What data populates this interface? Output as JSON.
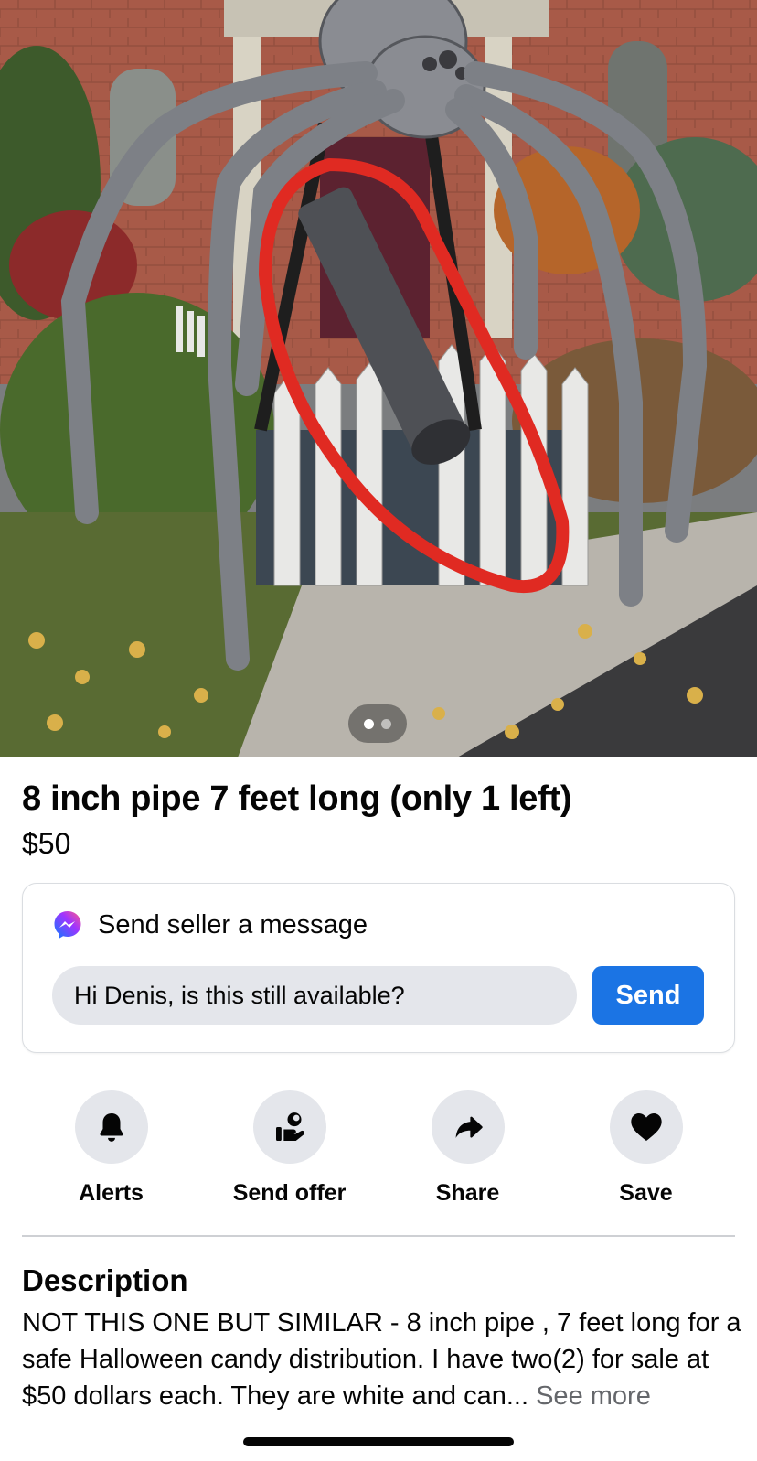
{
  "listing": {
    "title": "8 inch pipe 7 feet long (only 1 left)",
    "price": "$50"
  },
  "photo": {
    "current_page": 1,
    "page_count": 2
  },
  "message": {
    "heading": "Send seller a message",
    "input_value": "Hi Denis, is this still available?",
    "send_label": "Send"
  },
  "actions": [
    {
      "label": "Alerts",
      "icon": "bell-icon"
    },
    {
      "label": "Send offer",
      "icon": "offer-icon"
    },
    {
      "label": "Share",
      "icon": "share-arrow-icon"
    },
    {
      "label": "Save",
      "icon": "heart-icon"
    }
  ],
  "description": {
    "heading": "Description",
    "text": "NOT THIS ONE BUT SIMILAR - 8 inch pipe , 7 feet long for a safe Halloween candy distribution. I have two(2) for sale at $50 dollars each. They are white and can... ",
    "see_more": "See more"
  },
  "colors": {
    "accent": "#1b74e4",
    "muted_text": "#65676b",
    "chip_bg": "#e4e6eb",
    "annotation_red": "#e02a22"
  }
}
